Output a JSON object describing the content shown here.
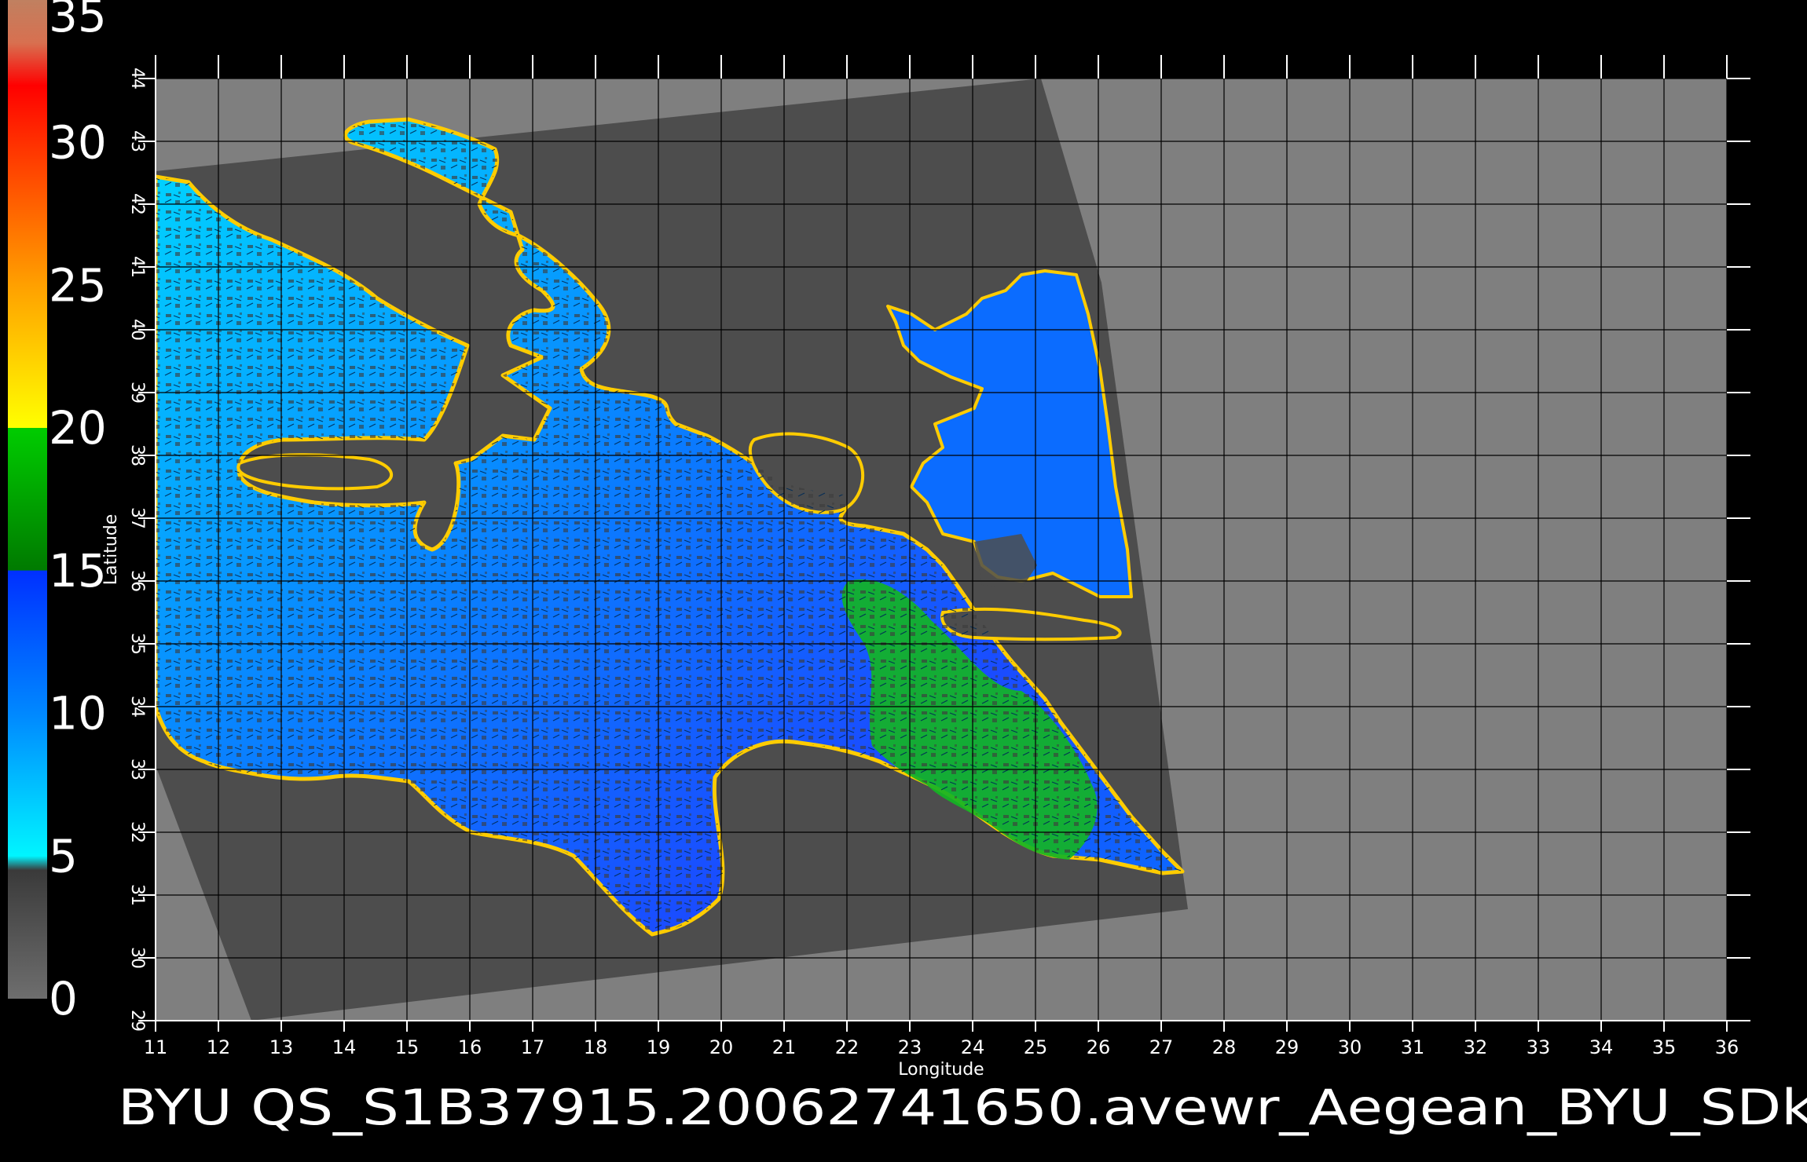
{
  "map": {
    "x_axis_title": "Longitude",
    "y_axis_title": "Latitude",
    "lon_range": [
      11,
      36
    ],
    "lat_range": [
      29,
      44
    ],
    "lon_ticks": [
      "11",
      "12",
      "13",
      "14",
      "15",
      "16",
      "17",
      "18",
      "19",
      "20",
      "21",
      "22",
      "23",
      "24",
      "25",
      "26",
      "27",
      "28",
      "29",
      "30",
      "31",
      "32",
      "33",
      "34",
      "35",
      "36"
    ],
    "lat_ticks": [
      "29",
      "30",
      "31",
      "32",
      "33",
      "34",
      "35",
      "36",
      "37",
      "38",
      "39",
      "40",
      "41",
      "42",
      "43",
      "44"
    ],
    "grid": true,
    "colors": {
      "background": "#000000",
      "no_data": "#7f7f7f",
      "land_mask": "#4d4d4d",
      "grid_line": "#000000"
    }
  },
  "colorbar": {
    "labels": [
      "0",
      "5",
      "10",
      "15",
      "20",
      "25",
      "30",
      "35"
    ],
    "range": [
      0,
      35
    ],
    "stops": [
      {
        "value": 0,
        "color": "#6e6e6e"
      },
      {
        "value": 4.5,
        "color": "#3a3a3a"
      },
      {
        "value": 5,
        "color": "#00f5ff"
      },
      {
        "value": 10,
        "color": "#0088ff"
      },
      {
        "value": 15,
        "color": "#0030ff"
      },
      {
        "value": 15.01,
        "color": "#007a00"
      },
      {
        "value": 20,
        "color": "#00cc00"
      },
      {
        "value": 20.01,
        "color": "#ffff00"
      },
      {
        "value": 25,
        "color": "#ffa000"
      },
      {
        "value": 30,
        "color": "#ff3000"
      },
      {
        "value": 32,
        "color": "#ff0000"
      },
      {
        "value": 33.5,
        "color": "#d87050"
      },
      {
        "value": 35,
        "color": "#c08060"
      }
    ]
  },
  "footer": {
    "title": "BYU  QS_S1B37915.20062741650.avewr_Aegean_BYU_SDk"
  }
}
